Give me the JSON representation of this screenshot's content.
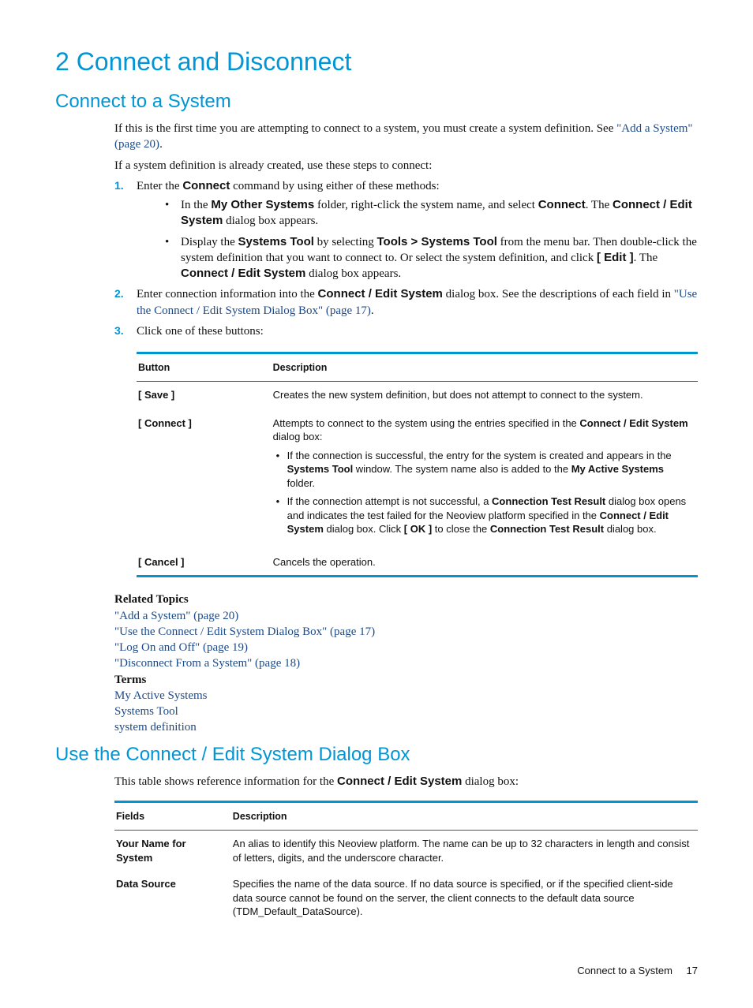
{
  "h1": "2 Connect and Disconnect",
  "section1": {
    "title": "Connect to a System",
    "p1a": "If this is the first time you are attempting to connect to a system, you must create a system definition. See ",
    "p1link": "\"Add a System\" (page 20)",
    "p1b": ".",
    "p2": "If a system definition is already created, use these steps to connect:",
    "steps": {
      "s1": {
        "num": "1.",
        "pre": "Enter the ",
        "cmd": "Connect",
        "post": " command by using either of these methods:",
        "b1": {
          "a": "In the ",
          "b": "My Other Systems",
          "c": " folder, right-click the system name, and select ",
          "d": "Connect",
          "e": ". The ",
          "f": "Connect / Edit System",
          "g": " dialog box appears."
        },
        "b2": {
          "a": "Display the ",
          "b": "Systems Tool",
          "c": " by selecting ",
          "d": "Tools > Systems Tool",
          "e": " from the menu bar. Then double-click the system definition that you want to connect to. Or select the system definition, and click ",
          "f": "[ Edit ]",
          "g": ". The ",
          "h": "Connect / Edit System",
          "i": " dialog box appears."
        }
      },
      "s2": {
        "num": "2.",
        "a": "Enter connection information into the ",
        "b": "Connect / Edit System",
        "c": " dialog box. See the descriptions of each field in ",
        "link": "\"Use the Connect / Edit System Dialog Box\" (page 17)",
        "d": "."
      },
      "s3": {
        "num": "3.",
        "text": "Click one of these buttons:"
      }
    },
    "table1": {
      "h1": "Button",
      "h2": "Description",
      "r1": {
        "c1": "[ Save ]",
        "c2": "Creates the new system definition, but does not attempt to connect to the system."
      },
      "r2": {
        "c1": "[ Connect ]",
        "intro_a": "Attempts to connect to the system using the entries specified in the ",
        "intro_b": "Connect / Edit System",
        "intro_c": " dialog box:",
        "b1": {
          "a": "If the connection is successful, the entry for the system is created and appears in the ",
          "b": "Systems Tool",
          "c": " window. The system name also is added to the ",
          "d": "My Active Systems",
          "e": " folder."
        },
        "b2": {
          "a": "If the connection attempt is not successful, a ",
          "b": "Connection Test Result",
          "c": " dialog box opens and indicates the test failed for the Neoview platform specified in the ",
          "d": "Connect / Edit System",
          "e": " dialog box. Click ",
          "f": "[ OK ]",
          "g": " to close the ",
          "h": "Connection Test Result",
          "i": " dialog box."
        }
      },
      "r3": {
        "c1": "[ Cancel ]",
        "c2": "Cancels the operation."
      }
    },
    "related": {
      "hdr": "Related Topics",
      "l1": "\"Add a System\" (page 20)",
      "l2": "\"Use the Connect / Edit System Dialog Box\" (page 17)",
      "l3": "\"Log On and Off\" (page 19)",
      "l4": "\"Disconnect From a System\" (page 18)",
      "termsHdr": "Terms",
      "t1": "My Active Systems",
      "t2": "Systems Tool",
      "t3": "system definition"
    }
  },
  "section2": {
    "title": "Use the Connect / Edit System Dialog Box",
    "intro_a": "This table shows reference information for the ",
    "intro_b": "Connect / Edit System",
    "intro_c": " dialog box:",
    "table": {
      "h1": "Fields",
      "h2": "Description",
      "r1": {
        "c1": "Your Name for System",
        "c2": "An alias to identify this Neoview platform. The name can be up to 32 characters in length and consist of letters, digits, and the underscore character."
      },
      "r2": {
        "c1": "Data Source",
        "c2": "Specifies the name of the data source. If no data source is specified, or if the specified client-side data source cannot be found on the server, the client connects to the default data source (TDM_Default_DataSource)."
      }
    }
  },
  "footer": {
    "text": "Connect to a System",
    "page": "17"
  }
}
